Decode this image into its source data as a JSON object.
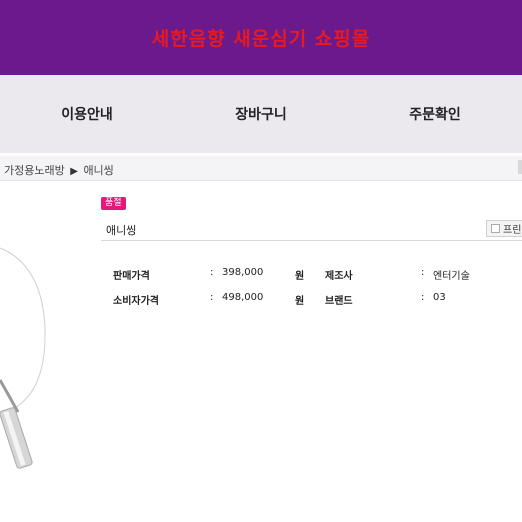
{
  "header": {
    "title": "세한음향 새운심기 쇼핑몰",
    "title_color": "#e8191f",
    "bg_color": "#6a1a8c"
  },
  "nav": {
    "items": [
      "이용안내",
      "장바구니",
      "주문확인"
    ]
  },
  "breadcrumb": {
    "category": "가정용노래방",
    "current": "애니씽",
    "separator": "▶"
  },
  "product": {
    "badge": "품절",
    "name": "애니씽",
    "print_label": "프린",
    "sale_price_label": "판매가격",
    "sale_price": "398,000",
    "consumer_price_label": "소비자가격",
    "consumer_price": "498,000",
    "currency": "원",
    "maker_label": "제조사",
    "maker": "엔터기술",
    "brand_label": "브랜드",
    "brand": "03",
    "colon": ":"
  }
}
